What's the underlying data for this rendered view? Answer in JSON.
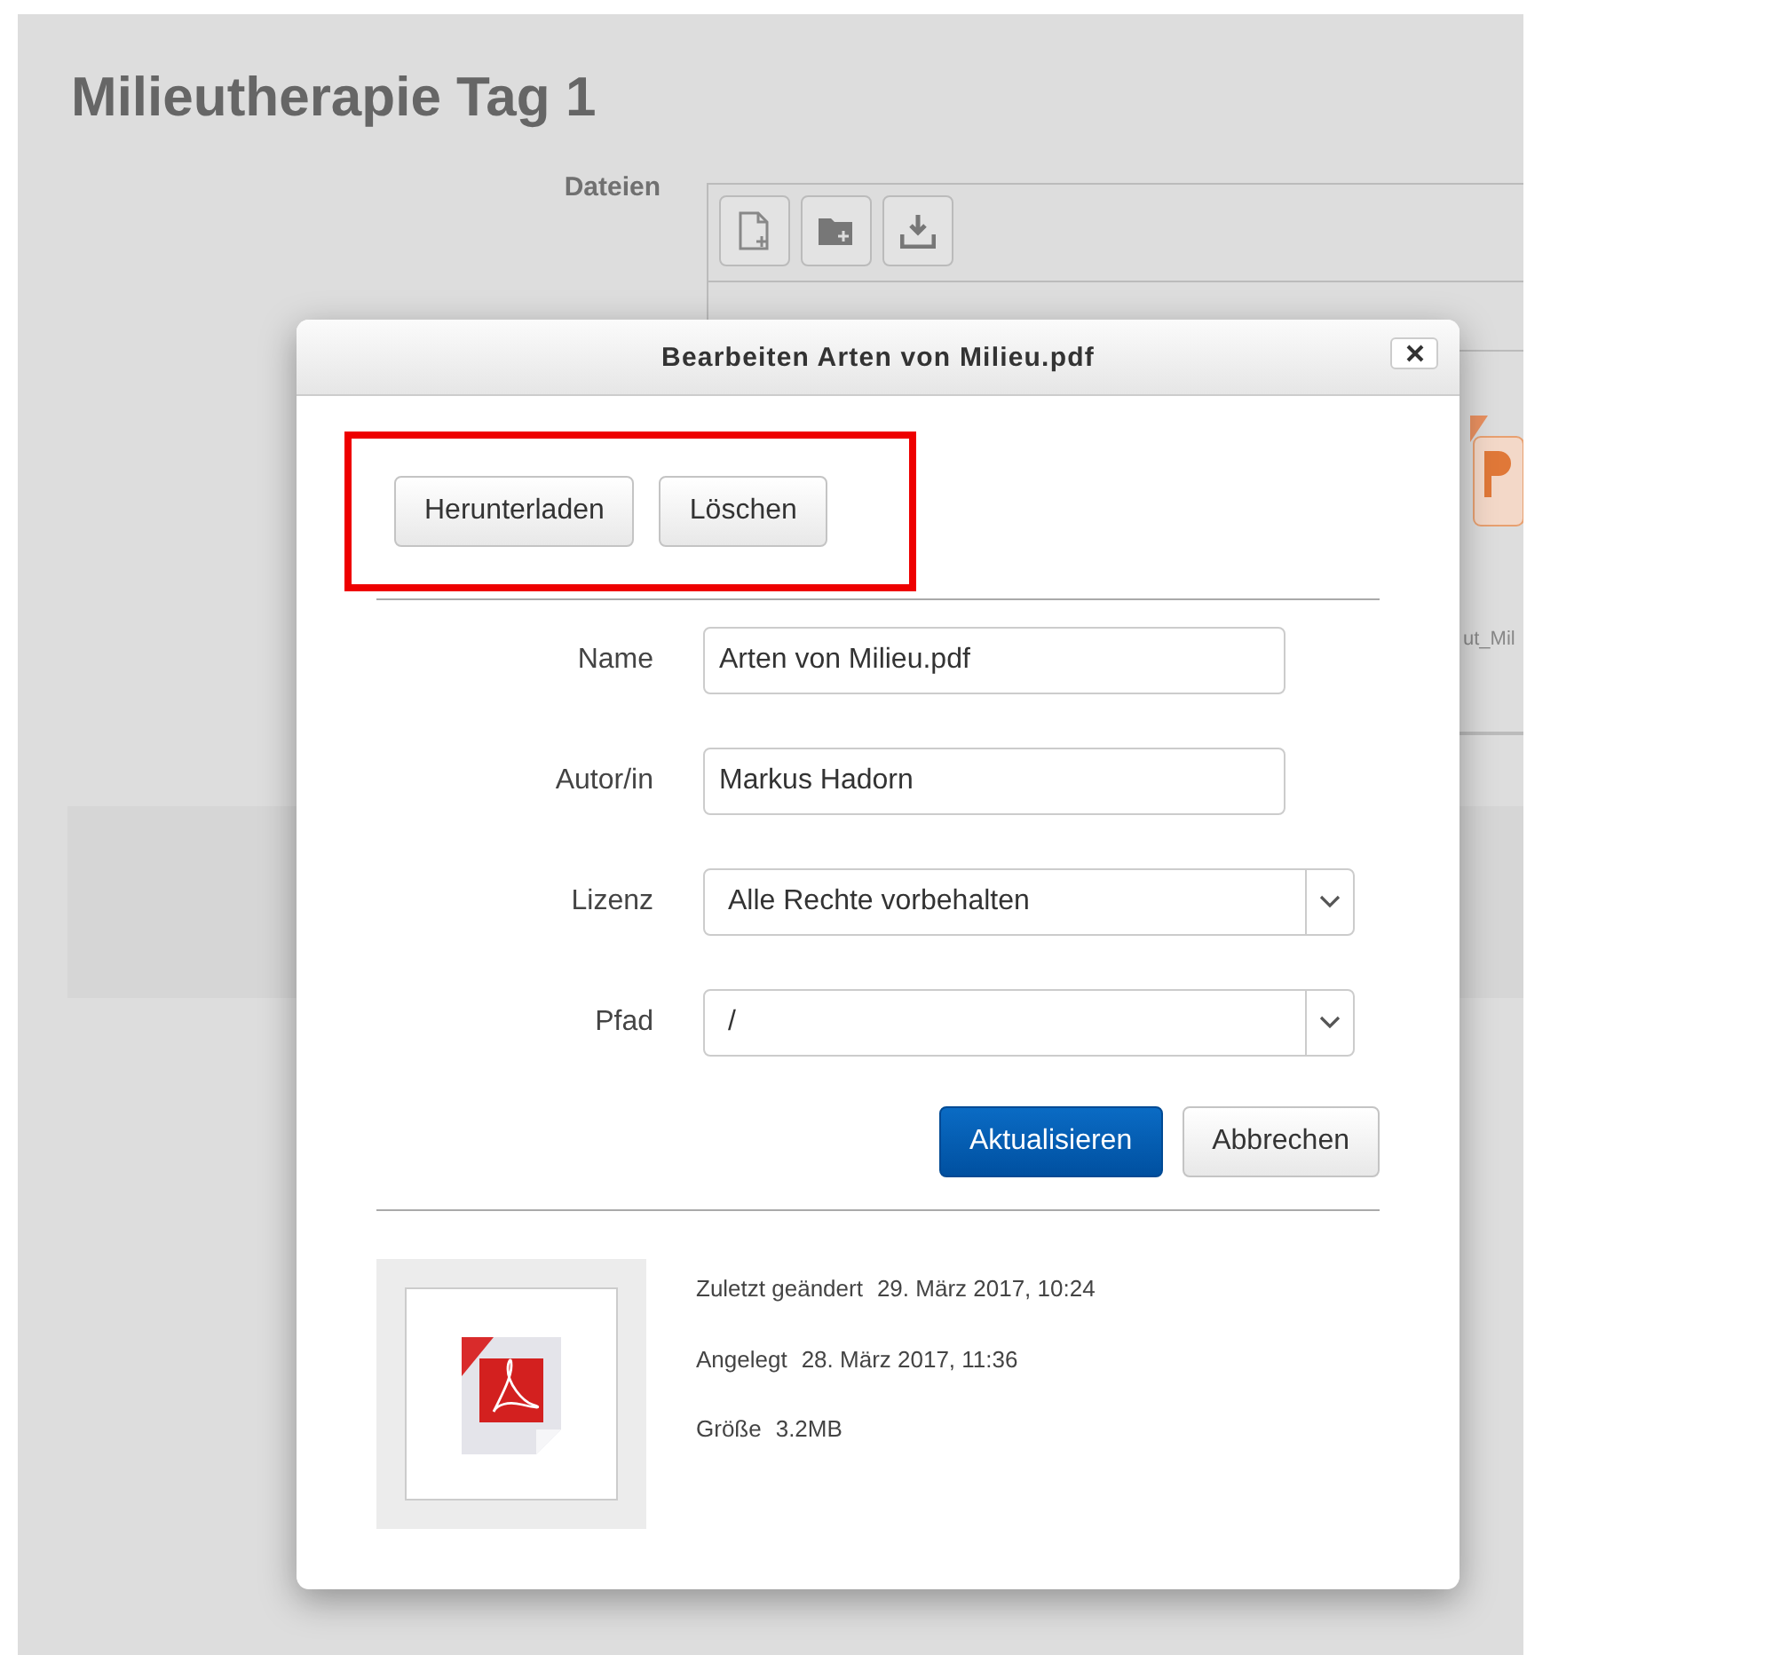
{
  "page": {
    "title": "Milieutherapie Tag 1",
    "files_label": "Dateien",
    "file_item": {
      "name": "ut_Mil"
    }
  },
  "dialog": {
    "title": "Bearbeiten Arten von Milieu.pdf",
    "actions_highlighted": true,
    "actions": [
      "Herunterladen",
      "Löschen"
    ],
    "fields": [
      {
        "kind": "text",
        "label": "Name",
        "value": "Arten von Milieu.pdf"
      },
      {
        "kind": "text",
        "label": "Autor/in",
        "value": "Markus Hadorn"
      },
      {
        "kind": "select",
        "label": "Lizenz",
        "value": "Alle Rechte vorbehalten"
      },
      {
        "kind": "select",
        "label": "Pfad",
        "value": "/"
      }
    ],
    "buttons": [
      {
        "kind": "primary",
        "label": "Aktualisieren"
      },
      {
        "kind": "secondary",
        "label": "Abbrechen"
      }
    ],
    "info": [
      {
        "label": "Zuletzt geändert",
        "value": "29. März 2017, 10:24"
      },
      {
        "label": "Angelegt",
        "value": "28. März 2017, 11:36"
      },
      {
        "label": "Größe",
        "value": "3.2MB"
      }
    ]
  }
}
